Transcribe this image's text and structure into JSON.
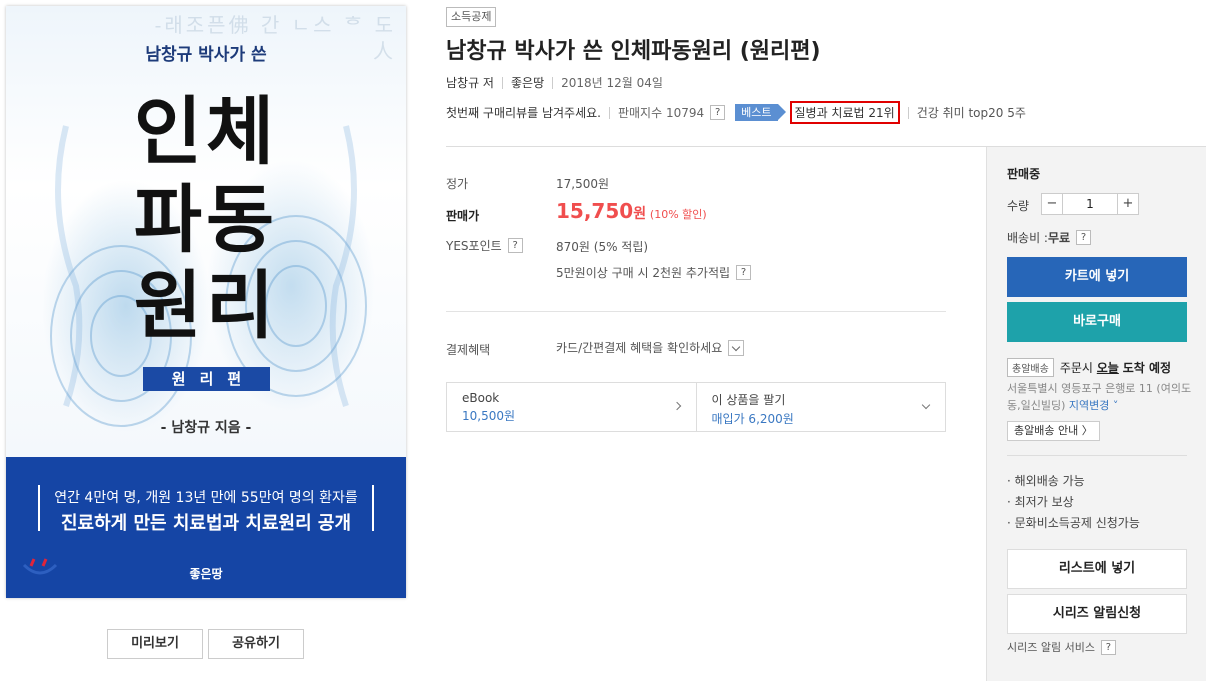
{
  "cover": {
    "subtitle": "남창규 박사가 쓴",
    "big_line1": "인체",
    "big_line2": "파동",
    "big_line3": "원리",
    "band": "원리편",
    "author": "- 남창규 지음 -",
    "blurb_line1": "연간 4만여 명, 개원 13년 만에 55만여 명의 환자를",
    "blurb_line2": "진료하게 만든 치료법과 치료원리 공개",
    "publisher_logo": "좋은땅",
    "bg_glyphs": "-래조픈佛 간 ㄴ스 ᄒ 도 人"
  },
  "cover_buttons": {
    "preview": "미리보기",
    "share": "공유하기"
  },
  "product": {
    "category_tag": "소득공제",
    "title": "남창규 박사가 쓴 인체파동원리 (원리편)",
    "author": "남창규 저",
    "publisher": "좋은땅",
    "date": "2018년 12월 04일",
    "review_prompt": "첫번째 구매리뷰를 남겨주세요.",
    "sales_index": "판매지수 10794",
    "best_tag": "베스트",
    "rank": "질병과 치료법 21위",
    "rank2": "건강 취미 top20 5주",
    "help": "?"
  },
  "price": {
    "list_label": "정가",
    "list_value": "17,500원",
    "sale_label": "판매가",
    "sale_value": "15,750",
    "sale_unit": "원",
    "sale_discount": "(10% 할인)",
    "points_label": "YES포인트",
    "points_value": "870원 (5% 적립)",
    "points_extra": "5만원이상 구매 시 2천원 추가적립",
    "benefit_label": "결제혜택",
    "benefit_value": "카드/간편결제 혜택을 확인하세요"
  },
  "other_formats": {
    "ebook_label": "eBook",
    "ebook_price": "10,500원",
    "sell_label": "이 상품을 팔기",
    "sell_price": "매입가 6,200원"
  },
  "panel": {
    "status": "판매중",
    "qty_label": "수량",
    "qty_minus": "−",
    "qty_value": "1",
    "qty_plus": "+",
    "ship_label": "배송비 : ",
    "ship_value": "무료",
    "cart_button": "카트에 넣기",
    "buy_button": "바로구매",
    "delivery_badge": "총알배송",
    "delivery_prefix": "주문시",
    "delivery_day": "오늘",
    "delivery_suffix": "도착 예정",
    "address": "서울특별시 영등포구 은행로 11 (여의도동,일신빌딩)",
    "address_change": "지역변경 ˅",
    "delivery_guide": "총알배송 안내 〉",
    "bullet1": "· 해외배송 가능",
    "bullet2": "· 최저가 보상",
    "bullet3": "· 문화비소득공제 신청가능",
    "list_button": "리스트에 넣기",
    "series_button": "시리즈 알림신청",
    "series_service": "시리즈 알림 서비스"
  }
}
